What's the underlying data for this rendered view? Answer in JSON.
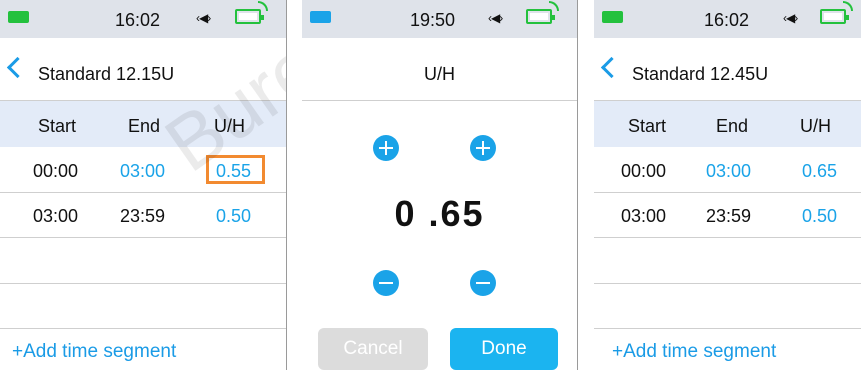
{
  "colors": {
    "accent": "#1aa3e8",
    "highlight": "#f28a30",
    "status_green": "#23c13d"
  },
  "watermark": "Bure",
  "screen1": {
    "time": "16:02",
    "signal": "‹◀›",
    "title": "Standard 12.15U",
    "headers": [
      "Start",
      "End",
      "U/H"
    ],
    "rows": [
      {
        "start": "00:00",
        "end": "03:00",
        "rate": "0.55"
      },
      {
        "start": "03:00",
        "end": "23:59",
        "rate": "0.50"
      }
    ],
    "add_label": "+Add time segment"
  },
  "screen2": {
    "time": "19:50",
    "signal": "‹◀›",
    "title": "U/H",
    "value": "0 .65",
    "cancel_label": "Cancel",
    "done_label": "Done"
  },
  "screen3": {
    "time": "16:02",
    "signal": "‹◀›",
    "title": "Standard 12.45U",
    "headers": [
      "Start",
      "End",
      "U/H"
    ],
    "rows": [
      {
        "start": "00:00",
        "end": "03:00",
        "rate": "0.65"
      },
      {
        "start": "03:00",
        "end": "23:59",
        "rate": "0.50"
      }
    ],
    "add_label": "+Add time segment"
  }
}
